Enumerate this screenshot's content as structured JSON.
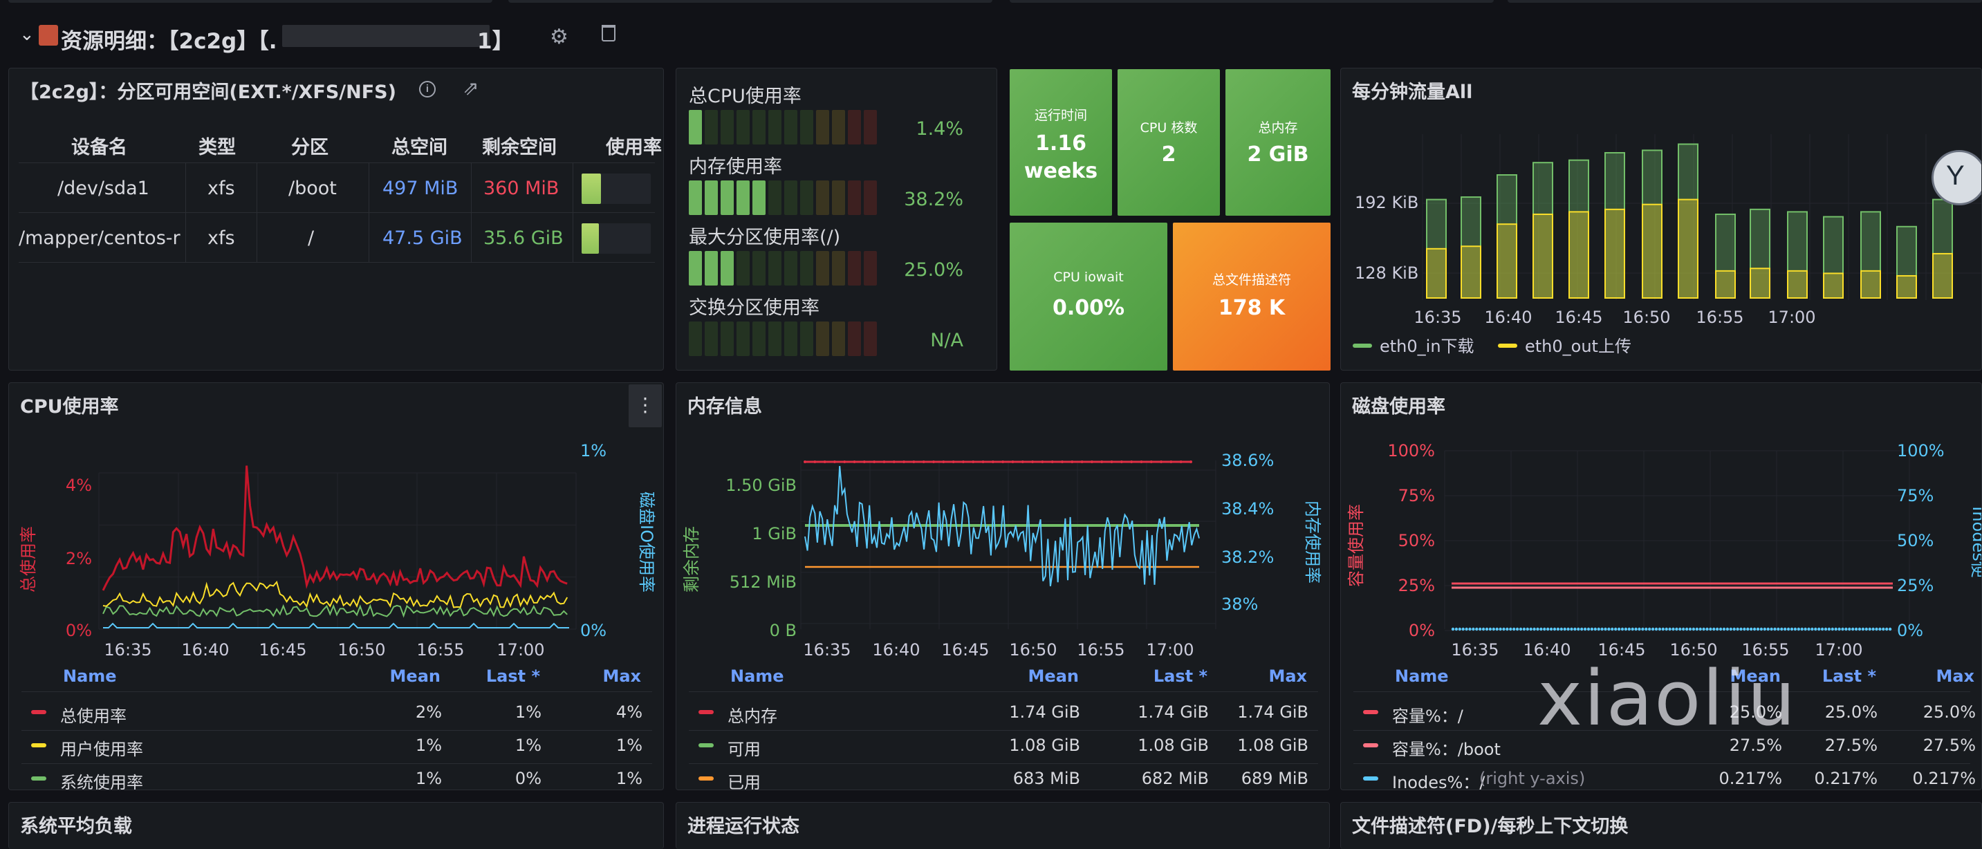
{
  "row": {
    "title": "资源明细：【2c2g】【.",
    "title_end": "1】"
  },
  "disk_table": {
    "title": "【2c2g】：分区可用空间(EXT.*/XFS/NFS)",
    "headers": [
      "设备名",
      "类型",
      "分区",
      "总空间",
      "剩余空间",
      "使用率"
    ],
    "rows": [
      {
        "device": "/dev/sda1",
        "type": "xfs",
        "mount": "/boot",
        "total": "497 MiB",
        "free": "360 MiB",
        "free_color": "#f2495c",
        "usage": 0.275
      },
      {
        "device": "/mapper/centos-r",
        "type": "xfs",
        "mount": "/",
        "total": "47.5 GiB",
        "free": "35.6 GiB",
        "free_color": "#73bf69",
        "usage": 0.25
      }
    ]
  },
  "gauges": [
    {
      "label": "总CPU使用率",
      "value": "1.4%",
      "filled": 1
    },
    {
      "label": "内存使用率",
      "value": "38.2%",
      "filled": 5
    },
    {
      "label": "最大分区使用率(/)",
      "value": "25.0%",
      "filled": 3
    },
    {
      "label": "交换分区使用率",
      "value": "N/A",
      "filled": 0
    }
  ],
  "stats": [
    {
      "label": "运行时间",
      "value": "1.16",
      "value2": "weeks",
      "color": "#56a64b"
    },
    {
      "label": "CPU 核数",
      "value": "2",
      "color": "#56a64b"
    },
    {
      "label": "总内存",
      "value": "2 GiB",
      "color": "#56a64b"
    },
    {
      "label": "CPU iowait",
      "value": "0.00%",
      "color": "#56a64b"
    },
    {
      "label": "总文件描述符",
      "value": "178 K",
      "color": "#f07a20"
    }
  ],
  "panels": {
    "traffic": "每分钟流量All",
    "cpu": "CPU使用率",
    "mem": "内存信息",
    "disk": "磁盘使用率",
    "load": "系统平均负载",
    "proc": "进程运行状态",
    "fd": "文件描述符(FD)/每秒上下文切换"
  },
  "traffic_chart": {
    "type": "bar",
    "yticks": [
      "192 KiB",
      "128 KiB"
    ],
    "xticks": [
      "16:35",
      "16:40",
      "16:45",
      "16:50",
      "16:55",
      "17:00"
    ],
    "legend": [
      "eth0_in下载",
      "eth0_out上传"
    ],
    "in_values": [
      180,
      182,
      200,
      210,
      212,
      218,
      220,
      225,
      168,
      172,
      170,
      166,
      170,
      158,
      180
    ],
    "out_values": [
      140,
      142,
      160,
      168,
      170,
      172,
      176,
      180,
      122,
      124,
      122,
      120,
      122,
      118,
      136
    ],
    "colors": {
      "in": "#73bf69",
      "out": "#fade2a"
    }
  },
  "cpu_chart": {
    "type": "line",
    "yleft": [
      "4%",
      "2%",
      "0%"
    ],
    "yright": [
      "1%",
      "0%"
    ],
    "ylabel_left": "总使用率",
    "ylabel_right": "磁盘IO使用率",
    "xticks": [
      "16:35",
      "16:40",
      "16:45",
      "16:50",
      "16:55",
      "17:00"
    ],
    "legend_headers": [
      "Name",
      "Mean",
      "Last *",
      "Max"
    ],
    "legend": [
      {
        "name": "总使用率",
        "mean": "2%",
        "last": "1%",
        "max": "4%",
        "color": "#e02f44"
      },
      {
        "name": "用户使用率",
        "mean": "1%",
        "last": "1%",
        "max": "1%",
        "color": "#fade2a"
      },
      {
        "name": "系统使用率",
        "mean": "1%",
        "last": "0%",
        "max": "1%",
        "color": "#73bf69"
      }
    ]
  },
  "mem_chart": {
    "type": "line",
    "yleft": [
      "1.50 GiB",
      "1 GiB",
      "512 MiB",
      "0 B"
    ],
    "yright": [
      "38.6%",
      "38.4%",
      "38.2%",
      "38%"
    ],
    "ylabel_left": "剩余内存",
    "ylabel_right": "内存使用率",
    "xticks": [
      "16:35",
      "16:40",
      "16:45",
      "16:50",
      "16:55",
      "17:00"
    ],
    "legend_headers": [
      "Name",
      "Mean",
      "Last *",
      "Max"
    ],
    "legend": [
      {
        "name": "总内存",
        "mean": "1.74 GiB",
        "last": "1.74 GiB",
        "max": "1.74 GiB",
        "color": "#e02f44"
      },
      {
        "name": "可用",
        "mean": "1.08 GiB",
        "last": "1.08 GiB",
        "max": "1.08 GiB",
        "color": "#73bf69"
      },
      {
        "name": "已用",
        "mean": "683 MiB",
        "last": "682 MiB",
        "max": "689 MiB",
        "color": "#ff9830"
      }
    ]
  },
  "disk_chart": {
    "type": "line",
    "yleft": [
      "100%",
      "75%",
      "50%",
      "25%",
      "0%"
    ],
    "yright": [
      "100%",
      "75%",
      "50%",
      "25%",
      "0%"
    ],
    "ylabel_left": "容量使用率",
    "ylabel_right": "Inodes使",
    "xticks": [
      "16:35",
      "16:40",
      "16:45",
      "16:50",
      "16:55",
      "17:00"
    ],
    "legend_headers": [
      "Name",
      "Mean",
      "Last *",
      "Max"
    ],
    "legend": [
      {
        "name": "容量%：/",
        "mean": "25.0%",
        "last": "25.0%",
        "max": "25.0%",
        "color": "#f2495c"
      },
      {
        "name": "容量%：/boot",
        "mean": "27.5%",
        "last": "27.5%",
        "max": "27.5%",
        "color": "#ff7383"
      },
      {
        "name": "Inodes%：/",
        "name_suffix": "(right y-axis)",
        "mean": "0.217%",
        "last": "0.217%",
        "max": "0.217%",
        "color": "#5ac8fa"
      }
    ]
  },
  "watermark": "xiaoliu"
}
